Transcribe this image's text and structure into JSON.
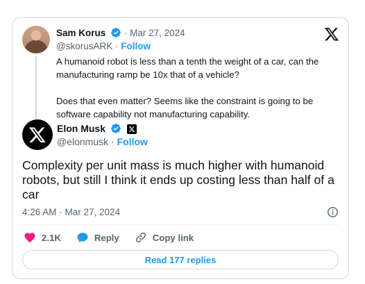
{
  "parent": {
    "name": "Sam Korus",
    "dot": "·",
    "date": "Mar 27, 2024",
    "handle": "@skorusARK",
    "follow_sep": "·",
    "follow": "Follow",
    "text": "A humanoid robot is less than a tenth the weight of a car, can the manufacturing ramp be 10x that of a vehicle?\n\nDoes that even matter? Seems like the constraint is going to be software capability not manufacturing capability."
  },
  "main": {
    "name": "Elon Musk",
    "handle": "@elonmusk",
    "follow_sep": "·",
    "follow": "Follow",
    "text": "Complexity per unit mass is much higher with humanoid robots, but still I think it ends up costing less than half of a car",
    "meta": "4:26 AM · Mar 27, 2024"
  },
  "actions": {
    "likes": "2.1K",
    "reply": "Reply",
    "copy_link": "Copy link"
  },
  "read_replies": "Read 177 replies",
  "colors": {
    "accent": "#1d9bf0",
    "like": "#f91880",
    "text": "#0f1419",
    "muted": "#536471"
  },
  "icons": [
    "x-logo-icon",
    "verified-badge-icon",
    "x-affiliate-badge-icon",
    "info-icon",
    "heart-icon",
    "reply-bubble-icon",
    "link-icon"
  ]
}
